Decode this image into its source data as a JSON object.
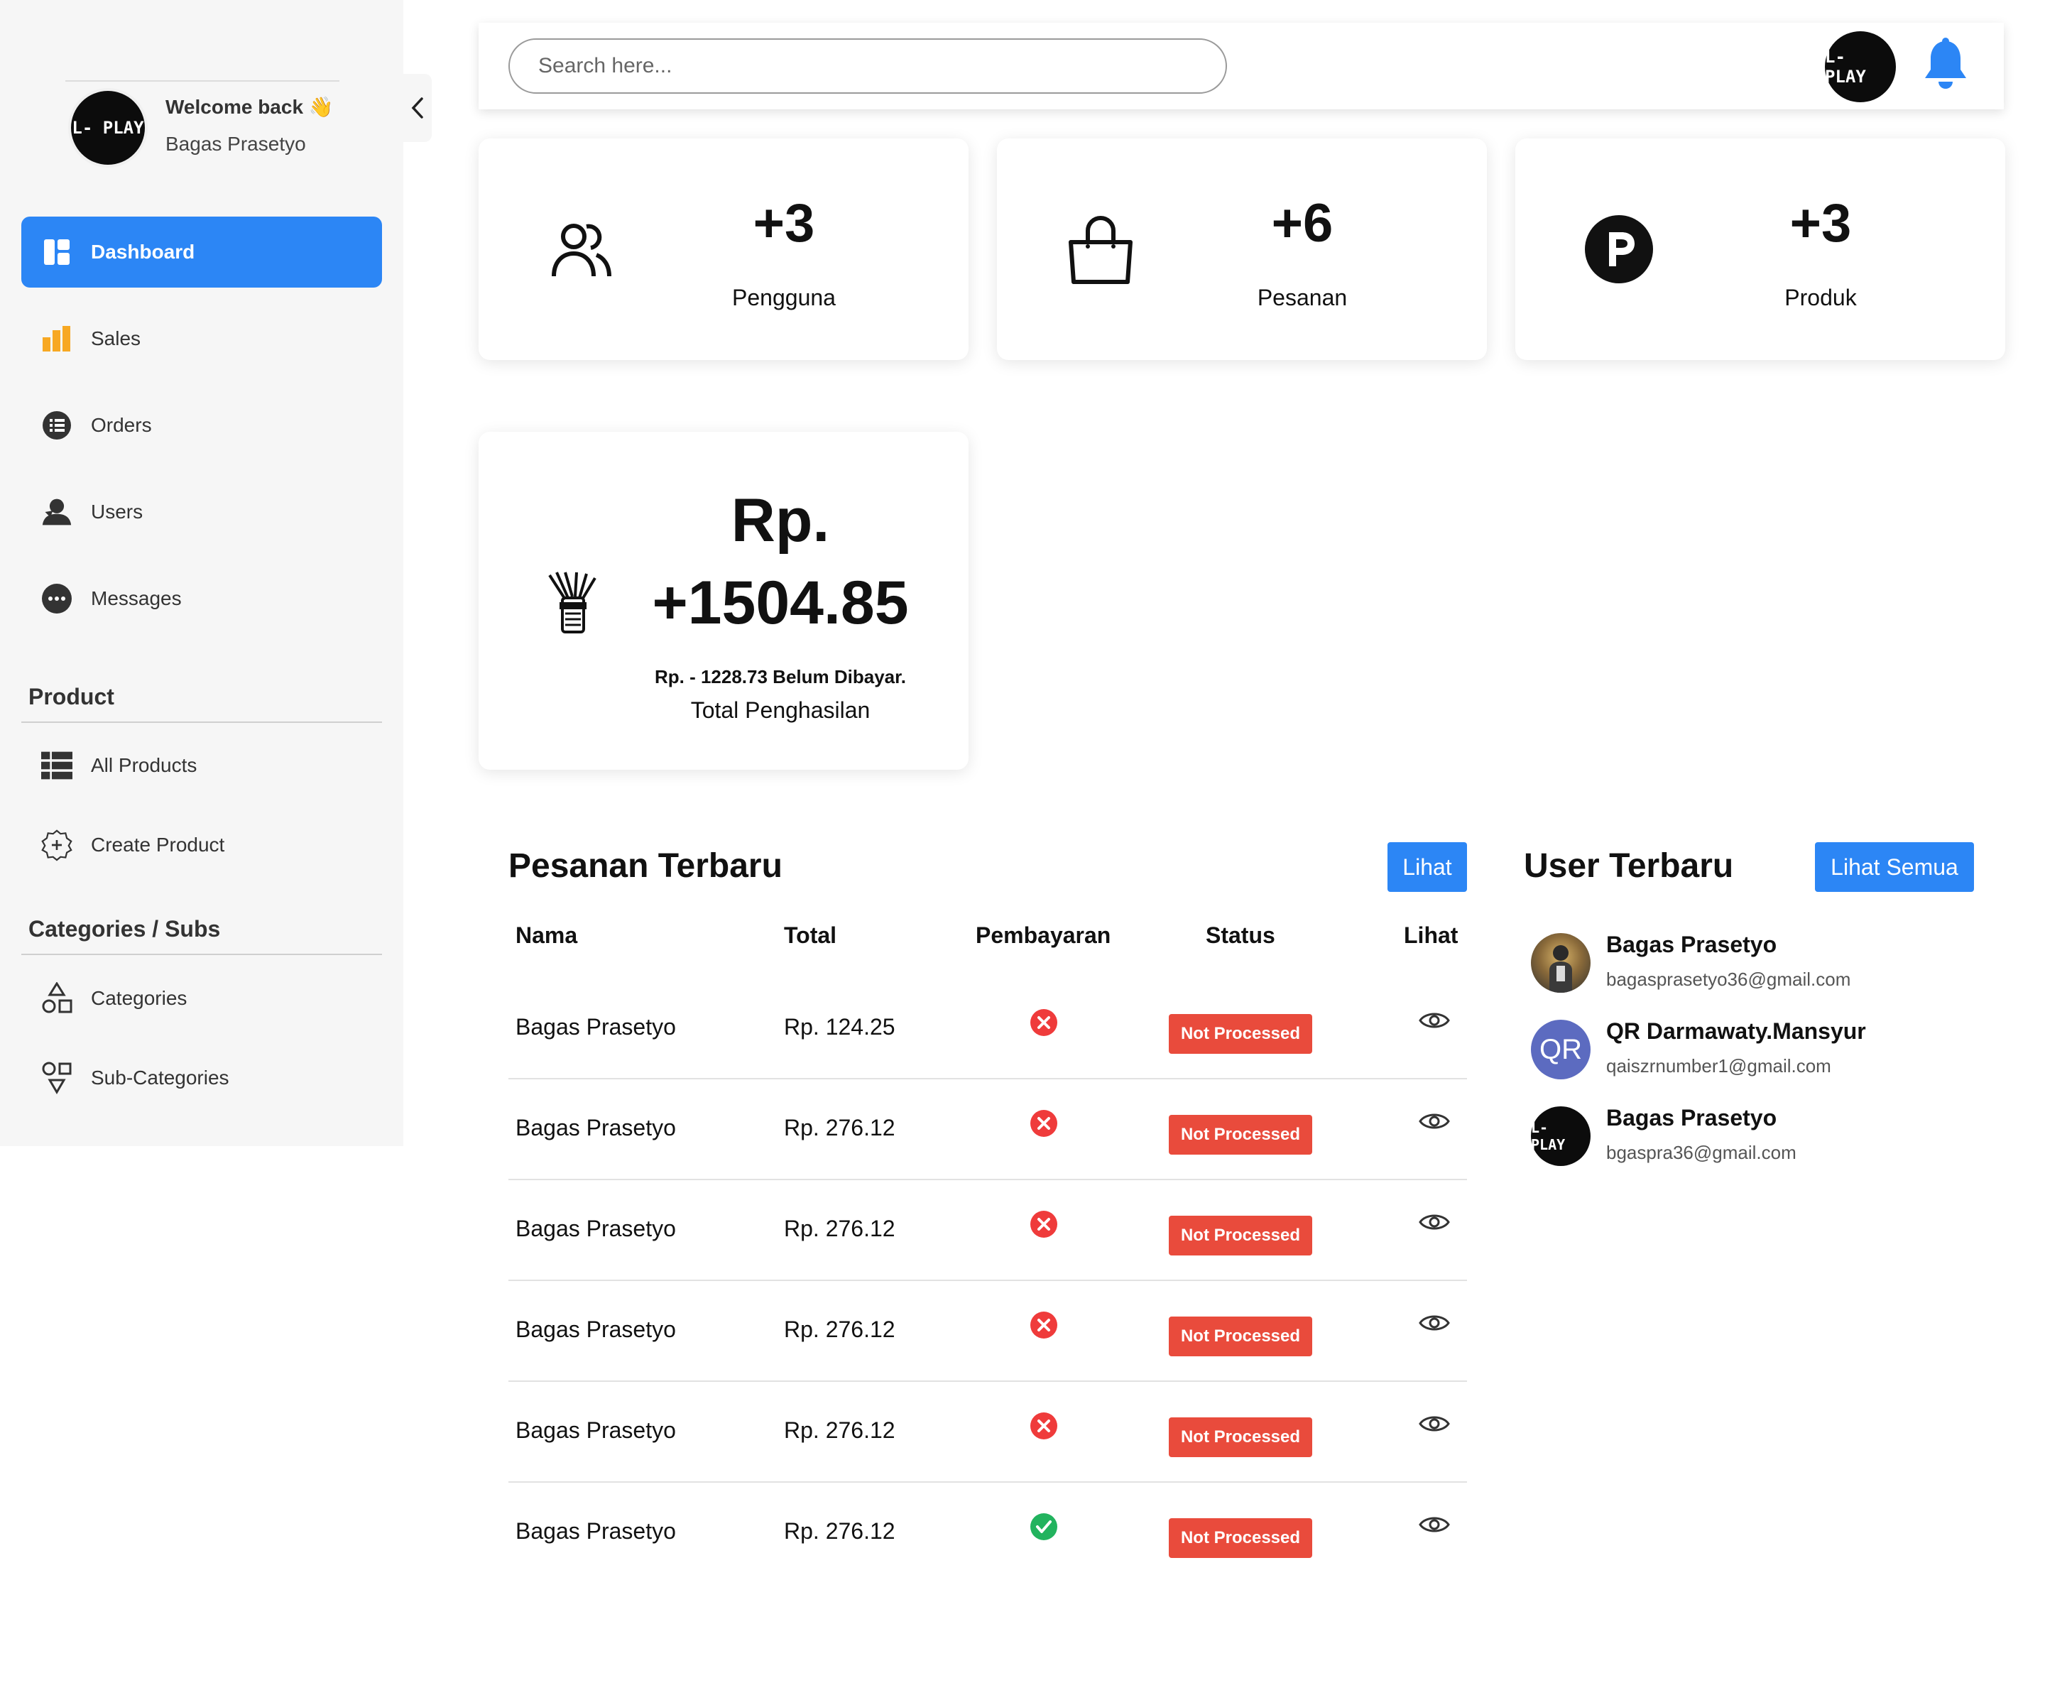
{
  "window": {
    "dots": [
      "#f25a53",
      "#f5b62e",
      "#3fcb3f"
    ]
  },
  "brand": {
    "logo_text": "L- PLAY"
  },
  "sidebar": {
    "welcome": "Welcome back 👋",
    "user_name": "Bagas Prasetyo",
    "nav": [
      {
        "label": "Dashboard",
        "icon": "dashboard-icon",
        "active": true
      },
      {
        "label": "Sales",
        "icon": "bar-chart-icon"
      },
      {
        "label": "Orders",
        "icon": "list-icon"
      },
      {
        "label": "Users",
        "icon": "user-icon"
      },
      {
        "label": "Messages",
        "icon": "chat-icon"
      }
    ],
    "product_section": "Product",
    "product_items": [
      {
        "label": "All Products",
        "icon": "table-icon"
      },
      {
        "label": "Create Product",
        "icon": "add-circle-icon"
      }
    ],
    "categories_section": "Categories / Subs",
    "category_items": [
      {
        "label": "Categories",
        "icon": "shapes-icon"
      },
      {
        "label": "Sub-Categories",
        "icon": "sub-shapes-icon"
      }
    ]
  },
  "topbar": {
    "search_placeholder": "Search here...",
    "avatar_text": "L- PLAY"
  },
  "stats": [
    {
      "value": "+3",
      "label": "Pengguna",
      "icon": "users-icon"
    },
    {
      "value": "+6",
      "label": "Pesanan",
      "icon": "shopping-bag-icon"
    },
    {
      "value": "+3",
      "label": "Produk",
      "icon": "product-p-icon"
    }
  ],
  "income": {
    "currency": "Rp.",
    "value": "+1504.85",
    "unpaid": "Rp. - 1228.73 Belum Dibayar.",
    "label": "Total Penghasilan",
    "icon": "money-icon"
  },
  "orders": {
    "title": "Pesanan Terbaru",
    "button": "Lihat",
    "columns": [
      "Nama",
      "Total",
      "Pembayaran",
      "Status",
      "Lihat"
    ],
    "rows": [
      {
        "name": "Bagas Prasetyo",
        "total": "Rp. 124.25",
        "paid": false,
        "status": "Not Processed"
      },
      {
        "name": "Bagas Prasetyo",
        "total": "Rp. 276.12",
        "paid": false,
        "status": "Not Processed"
      },
      {
        "name": "Bagas Prasetyo",
        "total": "Rp. 276.12",
        "paid": false,
        "status": "Not Processed"
      },
      {
        "name": "Bagas Prasetyo",
        "total": "Rp. 276.12",
        "paid": false,
        "status": "Not Processed"
      },
      {
        "name": "Bagas Prasetyo",
        "total": "Rp. 276.12",
        "paid": false,
        "status": "Not Processed"
      },
      {
        "name": "Bagas Prasetyo",
        "total": "Rp. 276.12",
        "paid": true,
        "status": "Not Processed"
      }
    ]
  },
  "users": {
    "title": "User Terbaru",
    "button": "Lihat Semua",
    "list": [
      {
        "name": "Bagas Prasetyo",
        "email": "bagasprasetyo36@gmail.com",
        "avatar": "photo"
      },
      {
        "name": "QR Darmawaty.Mansyur",
        "email": "qaiszrnumber1@gmail.com",
        "avatar": "QR"
      },
      {
        "name": "Bagas Prasetyo",
        "email": "bgaspra36@gmail.com",
        "avatar": "L- PLAY"
      }
    ]
  },
  "colors": {
    "primary": "#2c86f5",
    "danger": "#e94b3c",
    "success": "#22b35e",
    "error_icon": "#ef3b3b"
  }
}
